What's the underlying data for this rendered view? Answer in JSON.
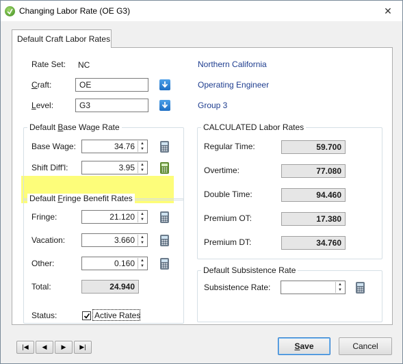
{
  "window": {
    "title": "Changing Labor Rate  (OE G3)",
    "close_glyph": "✕"
  },
  "tab": {
    "label": "Default Craft Labor Rates"
  },
  "rate_set": {
    "label": "Rate Set:",
    "value": "NC",
    "name": "Northern California"
  },
  "craft": {
    "label_prefix": "",
    "label_u": "C",
    "label_rest": "raft:",
    "value": "OE",
    "name": "Operating Engineer"
  },
  "level": {
    "label_u": "L",
    "label_rest": "evel:",
    "value": "G3",
    "name": "Group 3"
  },
  "base_wage_group": {
    "title_pre": "Default ",
    "title_u": "B",
    "title_rest": "ase Wage Rate",
    "base_wage": {
      "label": "Base Wage:",
      "value": "34.76"
    },
    "shift_diff": {
      "label": "Shift Diff'l:",
      "value": "3.95"
    }
  },
  "fringe_group": {
    "title_pre": "Default ",
    "title_u": "F",
    "title_rest": "ringe Benefit Rates",
    "fringe": {
      "label": "Fringe:",
      "value": "21.120"
    },
    "vacation": {
      "label": "Vacation:",
      "value": "3.660"
    },
    "other": {
      "label": "Other:",
      "value": "0.160"
    },
    "total": {
      "label": "Total:",
      "value": "24.940"
    }
  },
  "calculated_group": {
    "title": "CALCULATED Labor Rates",
    "regular": {
      "label": "Regular Time:",
      "value": "59.700"
    },
    "overtime": {
      "label": "Overtime:",
      "value": "77.080"
    },
    "double": {
      "label": "Double Time:",
      "value": "94.460"
    },
    "premium_ot": {
      "label": "Premium OT:",
      "value": "17.380"
    },
    "premium_dt": {
      "label": "Premium DT:",
      "value": "34.760"
    }
  },
  "subsistence_group": {
    "title": "Default Subsistence Rate",
    "subsistence": {
      "label": "Subsistence Rate:",
      "value": ""
    }
  },
  "status": {
    "label": "Status:",
    "checkbox_label": "Active Rates",
    "checked": true
  },
  "nav": {
    "first": "|◀",
    "prev": "◀",
    "next": "▶",
    "last": "▶|"
  },
  "buttons": {
    "save_u": "S",
    "save_rest": "ave",
    "cancel": "Cancel"
  },
  "colors": {
    "highlight": "#fdfd7a",
    "link": "#1e3d8f"
  },
  "icons": [
    "app-icon",
    "dropdown-arrow-icon",
    "calculator-icon",
    "checkmark-icon"
  ]
}
